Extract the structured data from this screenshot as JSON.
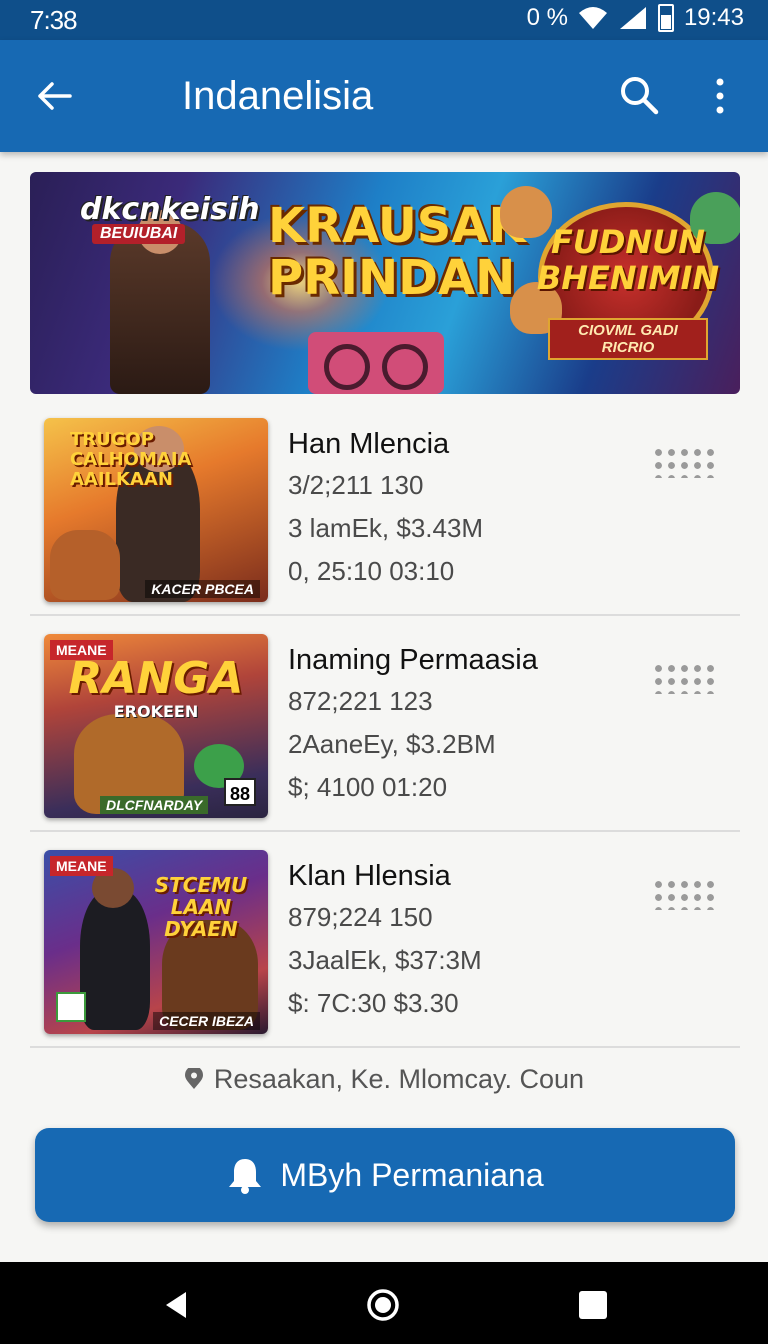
{
  "status_bar": {
    "time": "7:38",
    "vpn": "0 %",
    "right_time": "19:43"
  },
  "app_bar": {
    "title": "Indanelisia",
    "back_icon": "arrow-left-icon",
    "search_icon": "search-icon",
    "more_icon": "more-vert-icon"
  },
  "banner": {
    "left_title": "dkcnkeisih",
    "left_subtitle": "BEUIUBAI",
    "center_title": "KRAUSAK PRINDAN",
    "right_title": "FUDNUN BHENIMIN",
    "right_subtitle": "CIOVML GADI RICRIO"
  },
  "items": [
    {
      "thumb_tag": "TRUGOP",
      "thumb_title": "CALHOMAIA AAILKAAN",
      "thumb_caption": "KACER PBCEA",
      "title": "Han Mlencia",
      "line1": "3/2;211  130",
      "line2": "3 lamEk, $3.43M",
      "line3": "0, 25:10  03:10"
    },
    {
      "thumb_tag": "MEANE",
      "thumb_title": "RANGA",
      "thumb_sub": "EROKEEN",
      "thumb_caption": "DLCFNARDAY",
      "thumb_badge": "88",
      "title": "Inaming Permaasia",
      "line1": "872;221  123",
      "line2": "2AaneEy, $3.2BM",
      "line3": "$; 4100  01:20"
    },
    {
      "thumb_tag": "MEANE",
      "thumb_title": "STCEMU LAAN DYAEN",
      "thumb_caption": "CECER IBEZA",
      "title": "Klan Hlensia",
      "line1": "879;224  150",
      "line2": "3JaalEk, $37:3M",
      "line3": "$: 7C:30  $3.30"
    }
  ],
  "location": {
    "icon": "map-pin-icon",
    "text": "Resaakan, Ke. Mlomcay. Coun"
  },
  "cta": {
    "icon": "bell-icon",
    "label": "MByh Permaniana"
  },
  "colors": {
    "primary": "#1769b3",
    "status_bar": "#0f4f8a",
    "nav_bar": "#000000"
  }
}
